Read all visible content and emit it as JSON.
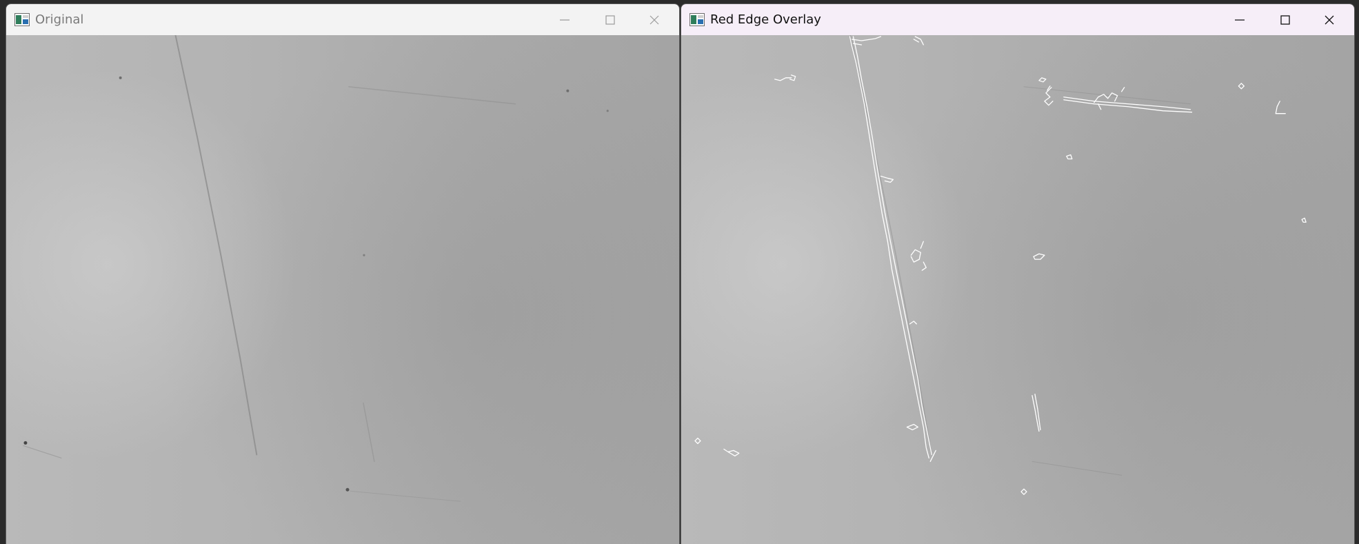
{
  "windows": {
    "left": {
      "title": "Original"
    },
    "right": {
      "title": "Red Edge Overlay"
    }
  },
  "icons": {
    "app": "opencv-window-icon",
    "minimize": "minimize-icon",
    "maximize": "maximize-icon",
    "close": "close-icon"
  },
  "colors": {
    "titlebar_left": "#f3f3f3",
    "titlebar_right": "#f6eef8",
    "edge_overlay": "#ffffff",
    "surface_gray": "#b1b1b1"
  }
}
